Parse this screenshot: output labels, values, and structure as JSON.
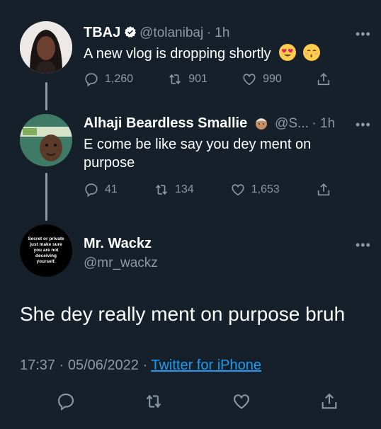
{
  "tweet1": {
    "name": "TBAJ",
    "handle": "@tolanibaj",
    "time": "· 1h",
    "text": "A new vlog is dropping shortly",
    "emoji": [
      "heart-eyes-emoji",
      "kissing-closed-eyes-emoji"
    ],
    "replies": "1,260",
    "retweets": "901",
    "likes": "990"
  },
  "tweet2": {
    "name": "Alhaji Beardless Smallie",
    "handle": "@S...",
    "time": "· 1h",
    "text_line1": "E come be like say you dey ment on",
    "text_line2": "purpose",
    "replies": "41",
    "retweets": "134",
    "likes": "1,653"
  },
  "tweet3": {
    "avatar_lines": [
      "Secret or private",
      "just make sure",
      "you are not",
      "deceiving",
      "yourself."
    ],
    "name": "Mr. Wackz",
    "handle": "@mr_wackz",
    "text": "She dey really ment on purpose bruh",
    "timestamp": "17:37 · 05/06/2022 ·",
    "source": "Twitter for iPhone"
  },
  "more_label": "•••",
  "colors": {
    "background": "#15202b",
    "muted": "#8b98a5",
    "link": "#1d9bf0"
  }
}
